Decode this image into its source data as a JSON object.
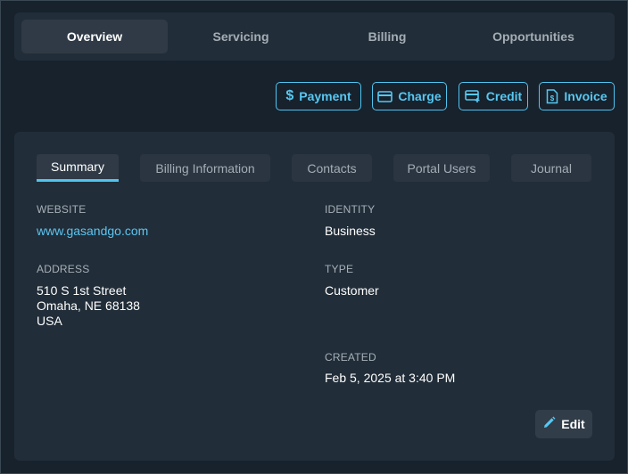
{
  "top_tabs": [
    {
      "label": "Overview",
      "active": true
    },
    {
      "label": "Servicing",
      "active": false
    },
    {
      "label": "Billing",
      "active": false
    },
    {
      "label": "Opportunities",
      "active": false
    }
  ],
  "actions": {
    "payment": "Payment",
    "charge": "Charge",
    "credit": "Credit",
    "invoice": "Invoice"
  },
  "sub_tabs": [
    {
      "label": "Summary",
      "active": true
    },
    {
      "label": "Billing Information",
      "active": false
    },
    {
      "label": "Contacts",
      "active": false
    },
    {
      "label": "Portal Users",
      "active": false
    },
    {
      "label": "Journal",
      "active": false
    }
  ],
  "summary": {
    "website_label": "WEBSITE",
    "website_value": "www.gasandgo.com",
    "identity_label": "IDENTITY",
    "identity_value": "Business",
    "address_label": "ADDRESS",
    "address_line1": "510 S 1st Street",
    "address_line2": "Omaha, NE 68138",
    "address_line3": "USA",
    "type_label": "TYPE",
    "type_value": "Customer",
    "created_label": "CREATED",
    "created_value": "Feb 5, 2025 at 3:40 PM"
  },
  "edit_label": "Edit",
  "colors": {
    "accent": "#4fc4f0",
    "background": "#17222d",
    "panel": "#212d38"
  }
}
